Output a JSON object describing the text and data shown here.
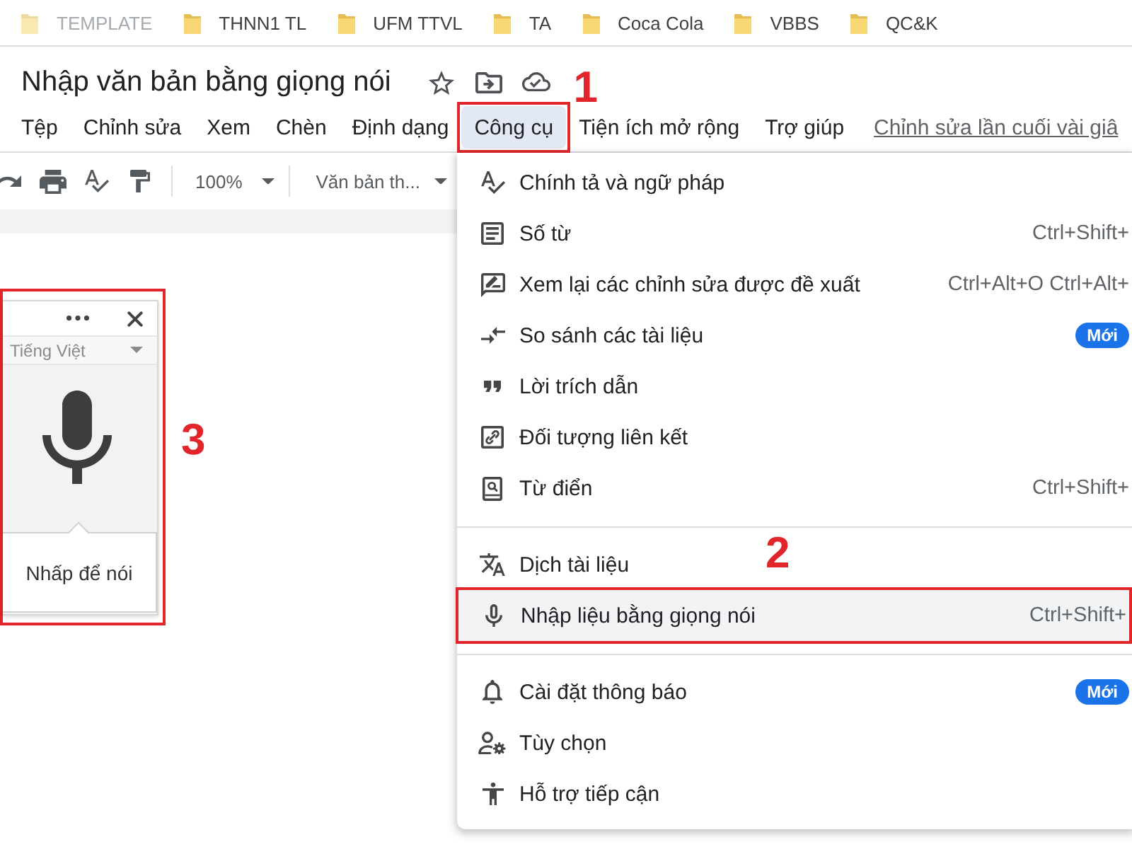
{
  "bookmarks": [
    {
      "label": "TEMPLATE",
      "dimmed": true
    },
    {
      "label": "THNN1 TL",
      "dimmed": false
    },
    {
      "label": "UFM TTVL",
      "dimmed": false
    },
    {
      "label": "TA",
      "dimmed": false
    },
    {
      "label": "Coca Cola",
      "dimmed": false
    },
    {
      "label": "VBBS",
      "dimmed": false
    },
    {
      "label": "QC&K",
      "dimmed": false
    }
  ],
  "document": {
    "title": "Nhập văn bản bằng giọng nói"
  },
  "menu_bar": {
    "items": [
      {
        "label": "Tệp",
        "selected": false
      },
      {
        "label": "Chỉnh sửa",
        "selected": false
      },
      {
        "label": "Xem",
        "selected": false
      },
      {
        "label": "Chèn",
        "selected": false
      },
      {
        "label": "Định dạng",
        "selected": false
      },
      {
        "label": "Công cụ",
        "selected": true,
        "callout": "1"
      },
      {
        "label": "Tiện ích mở rộng",
        "selected": false
      },
      {
        "label": "Trợ giúp",
        "selected": false
      }
    ],
    "last_edit": "Chỉnh sửa lần cuối vài giâ"
  },
  "toolbar": {
    "zoom": "100%",
    "paragraph_style": "Văn bản th..."
  },
  "voice_panel": {
    "language": "Tiếng Việt",
    "prompt": "Nhấp để nói",
    "callout": "3"
  },
  "tools_menu": {
    "groups": [
      [
        {
          "label": "Chính tả và ngữ pháp",
          "selected": false
        },
        {
          "label": "Số từ",
          "shortcut": "Ctrl+Shift+",
          "selected": false
        },
        {
          "label": "Xem lại các chỉnh sửa được đề xuất",
          "shortcut": "Ctrl+Alt+O Ctrl+Alt+",
          "selected": false
        },
        {
          "label": "So sánh các tài liệu",
          "badge": "Mới",
          "selected": false
        },
        {
          "label": "Lời trích dẫn",
          "selected": false
        },
        {
          "label": "Đối tượng liên kết",
          "selected": false
        },
        {
          "label": "Từ điển",
          "shortcut": "Ctrl+Shift+",
          "selected": false
        }
      ],
      [
        {
          "label": "Dịch tài liệu",
          "selected": false
        },
        {
          "label": "Nhập liệu bằng giọng nói",
          "shortcut": "Ctrl+Shift+",
          "selected": true,
          "callout": "2"
        }
      ],
      [
        {
          "label": "Cài đặt thông báo",
          "badge": "Mới",
          "selected": false
        },
        {
          "label": "Tùy chọn",
          "selected": false
        },
        {
          "label": "Hỗ trợ tiếp cận",
          "selected": false
        }
      ]
    ]
  }
}
